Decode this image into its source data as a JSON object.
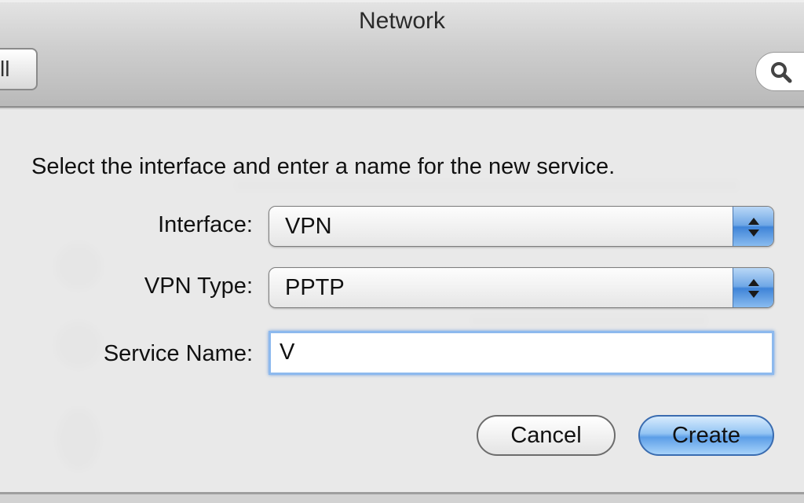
{
  "window": {
    "title": "Network"
  },
  "toolbar": {
    "show_all_label": "ll",
    "search_icon": "magnifier-icon"
  },
  "sheet": {
    "prompt": "Select the interface and enter a name for the new service.",
    "interface": {
      "label": "Interface:",
      "value": "VPN"
    },
    "vpn_type": {
      "label": "VPN Type:",
      "value": "PPTP"
    },
    "service_name": {
      "label": "Service Name:",
      "value": "V"
    },
    "buttons": {
      "cancel": "Cancel",
      "create": "Create"
    }
  },
  "colors": {
    "accent_blue": "#5c9ee7",
    "focus_ring": "#8db9ee"
  }
}
